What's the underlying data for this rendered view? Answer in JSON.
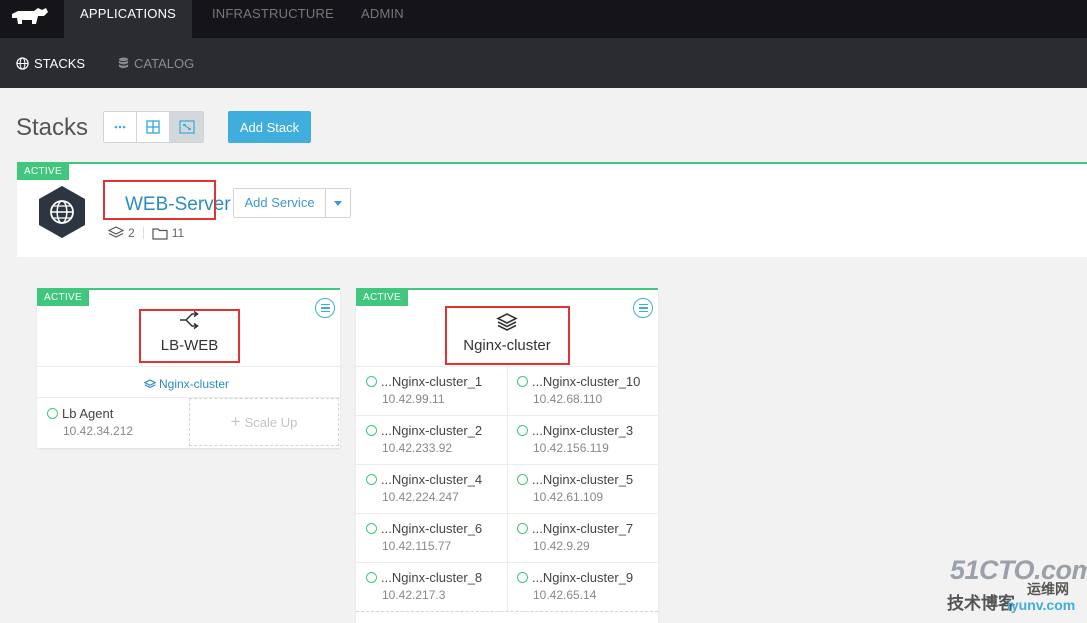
{
  "nav": {
    "top": [
      "APPLICATIONS",
      "INFRASTRUCTURE",
      "ADMIN"
    ],
    "sub": [
      "STACKS",
      "CATALOG"
    ]
  },
  "page": {
    "title": "Stacks",
    "add_stack": "Add Stack"
  },
  "stack": {
    "state": "ACTIVE",
    "name": "WEB-Server",
    "add_service": "Add Service",
    "service_count": "2",
    "container_count": "11"
  },
  "lb_card": {
    "state": "ACTIVE",
    "name": "LB-WEB",
    "link": "Nginx-cluster",
    "agent_name": "Lb Agent",
    "agent_ip": "10.42.34.212",
    "scale_up": "Scale Up"
  },
  "nginx_card": {
    "state": "ACTIVE",
    "name": "Nginx-cluster",
    "instances": [
      {
        "name": "...Nginx-cluster_1",
        "ip": "10.42.99.11"
      },
      {
        "name": "...Nginx-cluster_10",
        "ip": "10.42.68.110"
      },
      {
        "name": "...Nginx-cluster_2",
        "ip": "10.42.233.92"
      },
      {
        "name": "...Nginx-cluster_3",
        "ip": "10.42.156.119"
      },
      {
        "name": "...Nginx-cluster_4",
        "ip": "10.42.224.247"
      },
      {
        "name": "...Nginx-cluster_5",
        "ip": "10.42.61.109"
      },
      {
        "name": "...Nginx-cluster_6",
        "ip": "10.42.115.77"
      },
      {
        "name": "...Nginx-cluster_7",
        "ip": "10.42.9.29"
      },
      {
        "name": "...Nginx-cluster_8",
        "ip": "10.42.217.3"
      },
      {
        "name": "...Nginx-cluster_9",
        "ip": "10.42.65.14"
      }
    ]
  },
  "watermark": {
    "brand": "51CTO.com",
    "sub": "技术博客",
    "tag": "运维网",
    "url": "iyunv.com"
  },
  "colors": {
    "accent": "#3faedc",
    "active": "#41c77d",
    "highlight": "#e03434",
    "nav_bg": "#141419"
  },
  "icons": [
    "rancher-logo-icon",
    "globe-icon",
    "database-icon",
    "list-view-icon",
    "grid-view-icon",
    "graph-view-icon",
    "layers-icon",
    "folder-icon",
    "caret-down-icon",
    "load-balancer-icon",
    "menu-icon",
    "status-circle-icon",
    "plus-icon"
  ]
}
